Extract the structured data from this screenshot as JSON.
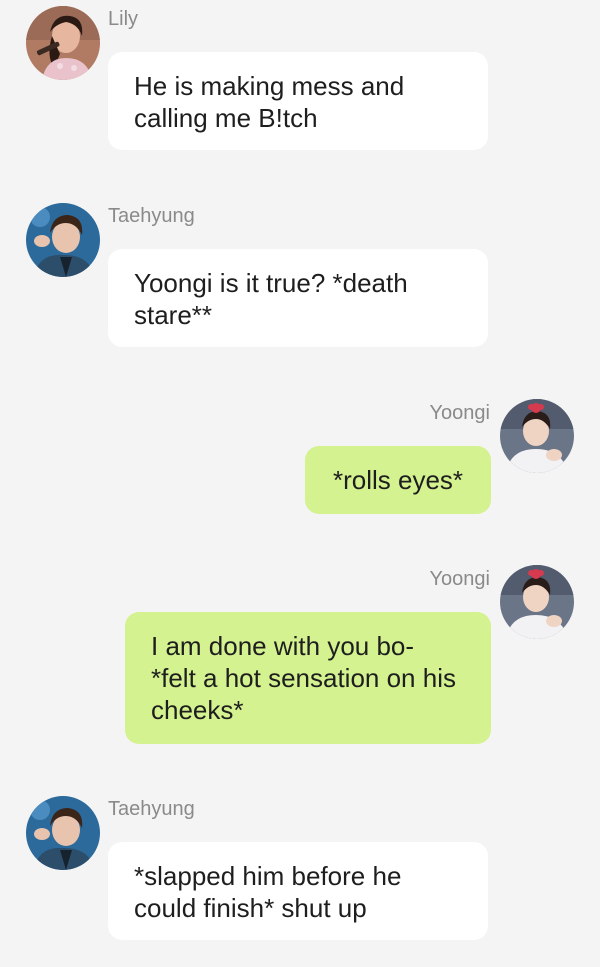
{
  "theme": {
    "background": "#f4f4f4",
    "incoming_bubble": "#ffffff",
    "outgoing_bubble": "#d4f290",
    "name_color": "#8a8a8a"
  },
  "messages": [
    {
      "sender": "Lily",
      "avatar": "lily-avatar",
      "direction": "incoming",
      "text": "He is making mess and calling me B!tch"
    },
    {
      "sender": "Taehyung",
      "avatar": "taehyung-avatar",
      "direction": "incoming",
      "text": "Yoongi is it true? *death stare**"
    },
    {
      "sender": "Yoongi",
      "avatar": "yoongi-avatar",
      "direction": "outgoing",
      "text": "*rolls eyes*"
    },
    {
      "sender": "Yoongi",
      "avatar": "yoongi-avatar",
      "direction": "outgoing",
      "text": "I am done with you bo- *felt a hot sensation on his cheeks*"
    },
    {
      "sender": "Taehyung",
      "avatar": "taehyung-avatar",
      "direction": "incoming",
      "text": "*slapped him before he could finish* shut up"
    }
  ]
}
